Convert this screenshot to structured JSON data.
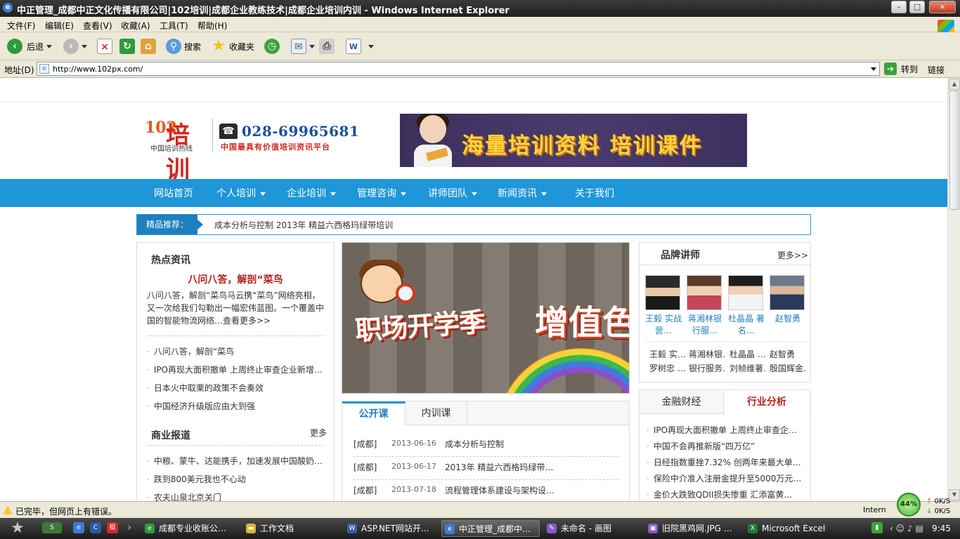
{
  "window": {
    "title": "中正管理_成都中正文化传播有限公司|102培训|成都企业教练技术|成都企业培训内训 - Windows Internet Explorer",
    "minimize": "0",
    "maximize": "□",
    "close": "×"
  },
  "menu": {
    "file": "文件(F)",
    "edit": "编辑(E)",
    "view": "查看(V)",
    "favorites": "收藏(A)",
    "tools": "工具(T)",
    "help": "帮助(H)"
  },
  "toolbar": {
    "back": "后退",
    "search": "搜索",
    "favorites": "收藏夹"
  },
  "address": {
    "label": "地址(D)",
    "url": "http://www.102px.com/",
    "go": "转到",
    "links": "链接"
  },
  "header": {
    "logo_num": "102",
    "logo_char": "培训",
    "logo_sub": "中国培训热线",
    "phone": "028-69965681",
    "slogan": "中国最具有价值培训资讯平台",
    "ad_text": "海量培训资料 培训课件"
  },
  "nav": {
    "items": [
      "网站首页",
      "个人培训",
      "企业培训",
      "管理咨询",
      "讲师团队",
      "新闻资讯",
      "关于我们"
    ]
  },
  "recommend": {
    "label": "精品推荐：",
    "text": "成本分析与控制   2013年  精益六西格玛绿带培训"
  },
  "hot": {
    "title": "热点资讯",
    "headline": "八问八答，解剖“菜鸟",
    "desc": "八问八答，解剖“菜鸟马云携“菜鸟”网络亮相，又一次给我们勾勒出一幅宏伟蓝图。一个覆盖中国的智能物流网络…查看更多>>",
    "items": [
      "八问八答，解剖“菜鸟",
      "IPO再现大面积撤单 上周终止审查企业新增…",
      "日本火中取栗的政策不会奏效",
      "中国经济升级版应由大到强"
    ]
  },
  "business": {
    "title": "商业报道",
    "more": "更多",
    "items": [
      "中粮、蒙牛、达能携手，加速发展中国酸奶…",
      "跌到800美元我也不心动",
      "农夫山泉北京关门"
    ]
  },
  "slider": {
    "text_left": "职场开学季",
    "text_right": "增值色"
  },
  "courses": {
    "tab_public": "公开课",
    "tab_inhouse": "内训课",
    "rows": [
      {
        "city": "[成都]",
        "date": "2013-06-16",
        "title": "成本分析与控制"
      },
      {
        "city": "[成都]",
        "date": "2013-06-17",
        "title": "2013年  精益六西格玛绿带…"
      },
      {
        "city": "[成都]",
        "date": "2013-07-18",
        "title": "流程管理体系建设与架构设…"
      }
    ]
  },
  "lecturers": {
    "title": "品牌讲师",
    "more": "更多>>",
    "cards": [
      {
        "name": "王毅 实战营…"
      },
      {
        "name": "蒋湘林银行服…"
      },
      {
        "name": "杜晶晶 著名…"
      },
      {
        "name": "赵智勇"
      }
    ],
    "names_row1": [
      "王毅 实…",
      "蒋湘林银…",
      "杜晶晶 …",
      "赵智勇"
    ],
    "names_row2": [
      "罗树忠 …",
      "银行服务…",
      "刘帧维著…",
      "殷国辉金…"
    ]
  },
  "industry": {
    "tab_finance": "金融财经",
    "tab_analysis": "行业分析",
    "items": [
      "IPO再现大面积撤单 上周终止审查企…",
      "中国不会再推新版“四万亿”",
      "日经指数重挫7.32% 创两年来最大单…",
      "保险中介准入注册金提升至5000万元…",
      "金价大跌致QDII损失惨重 汇添富黄…"
    ]
  },
  "status": {
    "message": "已完毕，但网页上有错误。",
    "zone": "Intern",
    "gauge": "44%",
    "up": "0K/S",
    "down": "0K/S"
  },
  "taskbar": {
    "tasks": [
      "成都专业收账公…",
      "工作文档",
      "ASP.NET网站开…",
      "中正管理_成都中…",
      "未命名 - 画图",
      "旧院黑鸡网.JPG …",
      "Microsoft Excel"
    ],
    "clock": "9:45"
  }
}
